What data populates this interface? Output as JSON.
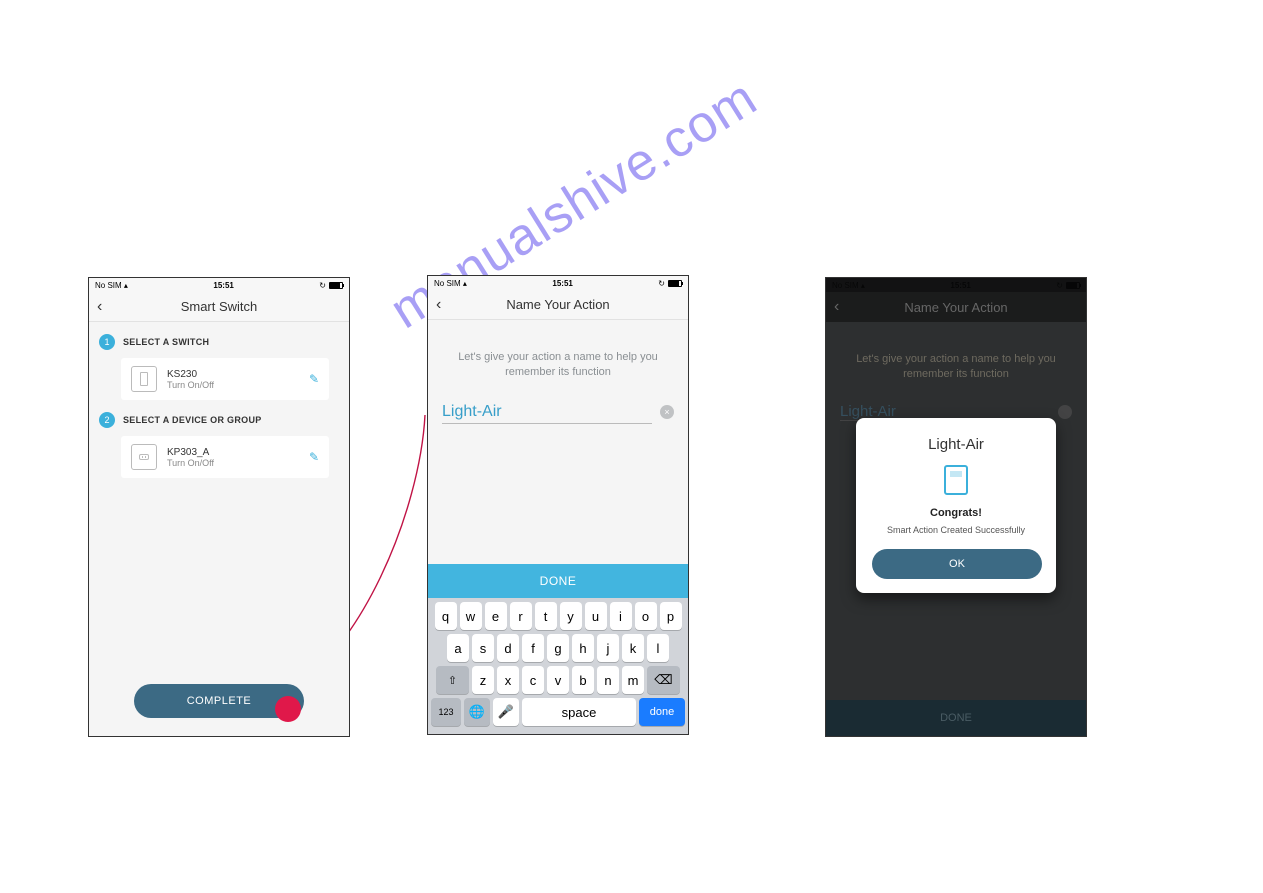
{
  "watermark": "manualshive.com",
  "status": {
    "carrier": "No SIM",
    "time": "15:51"
  },
  "screen1": {
    "title": "Smart Switch",
    "section1": {
      "step": "1",
      "label": "SELECT A SWITCH"
    },
    "device1": {
      "name": "KS230",
      "sub": "Turn On/Off"
    },
    "section2": {
      "step": "2",
      "label": "SELECT A DEVICE OR GROUP"
    },
    "device2": {
      "name": "KP303_A",
      "sub": "Turn On/Off"
    },
    "completeBtn": "COMPLETE"
  },
  "screen2": {
    "title": "Name Your Action",
    "hint": "Let's give your action a name to help you remember its function",
    "inputValue": "Light-Air",
    "doneBar": "DONE",
    "keyboard": {
      "row1": [
        "q",
        "w",
        "e",
        "r",
        "t",
        "y",
        "u",
        "i",
        "o",
        "p"
      ],
      "row2": [
        "a",
        "s",
        "d",
        "f",
        "g",
        "h",
        "j",
        "k",
        "l"
      ],
      "row3Mid": [
        "z",
        "x",
        "c",
        "v",
        "b",
        "n",
        "m"
      ],
      "numKey": "123",
      "space": "space",
      "done": "done"
    }
  },
  "screen3": {
    "title": "Name Your Action",
    "hint": "Let's give your action a name to help you remember its function",
    "inputValue": "Light-Air",
    "modal": {
      "title": "Light-Air",
      "congrats": "Congrats!",
      "message": "Smart Action Created Successfully",
      "ok": "OK"
    },
    "doneBar": "DONE"
  }
}
